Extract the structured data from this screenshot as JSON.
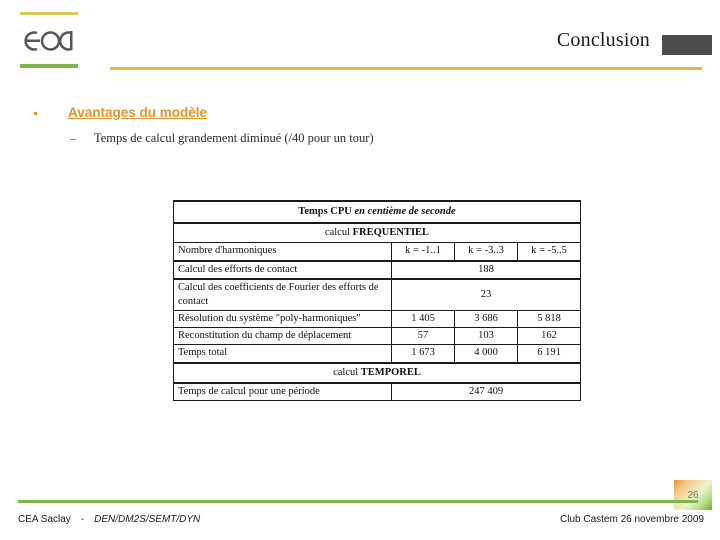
{
  "slide": {
    "title": "Conclusion",
    "logo_text": "cea",
    "colors": {
      "accent_orange": "#e8922c",
      "accent_gold": "#e8b93c",
      "accent_green": "#7ab648",
      "logo_rule_top": "#d9c85a",
      "title_block": "#4d4d4d"
    }
  },
  "content": {
    "bullet1": "Avantages du modèle",
    "bullet1_dash": "–",
    "subbullet1": "Temps de calcul  grandement diminué (/40 pour un tour)"
  },
  "table": {
    "title_plain": "Temps CPU ",
    "title_italic": "en centième de seconde",
    "section_frequential_prefix": "calcul ",
    "section_frequential_strong": "FREQUENTIEL",
    "section_temporal_prefix": "calcul ",
    "section_temporal_strong": "TEMPOREL",
    "harmonics_label": "Nombre d'harmoniques",
    "harmonics_columns": [
      "k = -1..1",
      "k = -3..3",
      "k = -5..5"
    ],
    "rows": [
      {
        "label": "Calcul des efforts de contact",
        "merged": true,
        "value": "188"
      },
      {
        "label": "Calcul des coefficients de Fourier des efforts de contact",
        "merged": true,
        "value": "23"
      },
      {
        "label": "Résolution du système \"poly-harmoniques\"",
        "merged": false,
        "values": [
          "1 405",
          "3 686",
          "5 818"
        ]
      },
      {
        "label": "Reconstitution du champ de déplacement",
        "merged": false,
        "values": [
          "57",
          "103",
          "162"
        ]
      },
      {
        "label": "Temps total",
        "merged": false,
        "values": [
          "1 673",
          "4 000",
          "6 191"
        ]
      }
    ],
    "temporal_row": {
      "label": "Temps de calcul pour une période",
      "value": "247 409"
    }
  },
  "footer": {
    "organisation": "CEA Saclay",
    "separator": "-",
    "unit": "DEN/DM2S/SEMT/DYN",
    "event": "Club Castem 26 novembre 2009",
    "page_number": "26"
  }
}
